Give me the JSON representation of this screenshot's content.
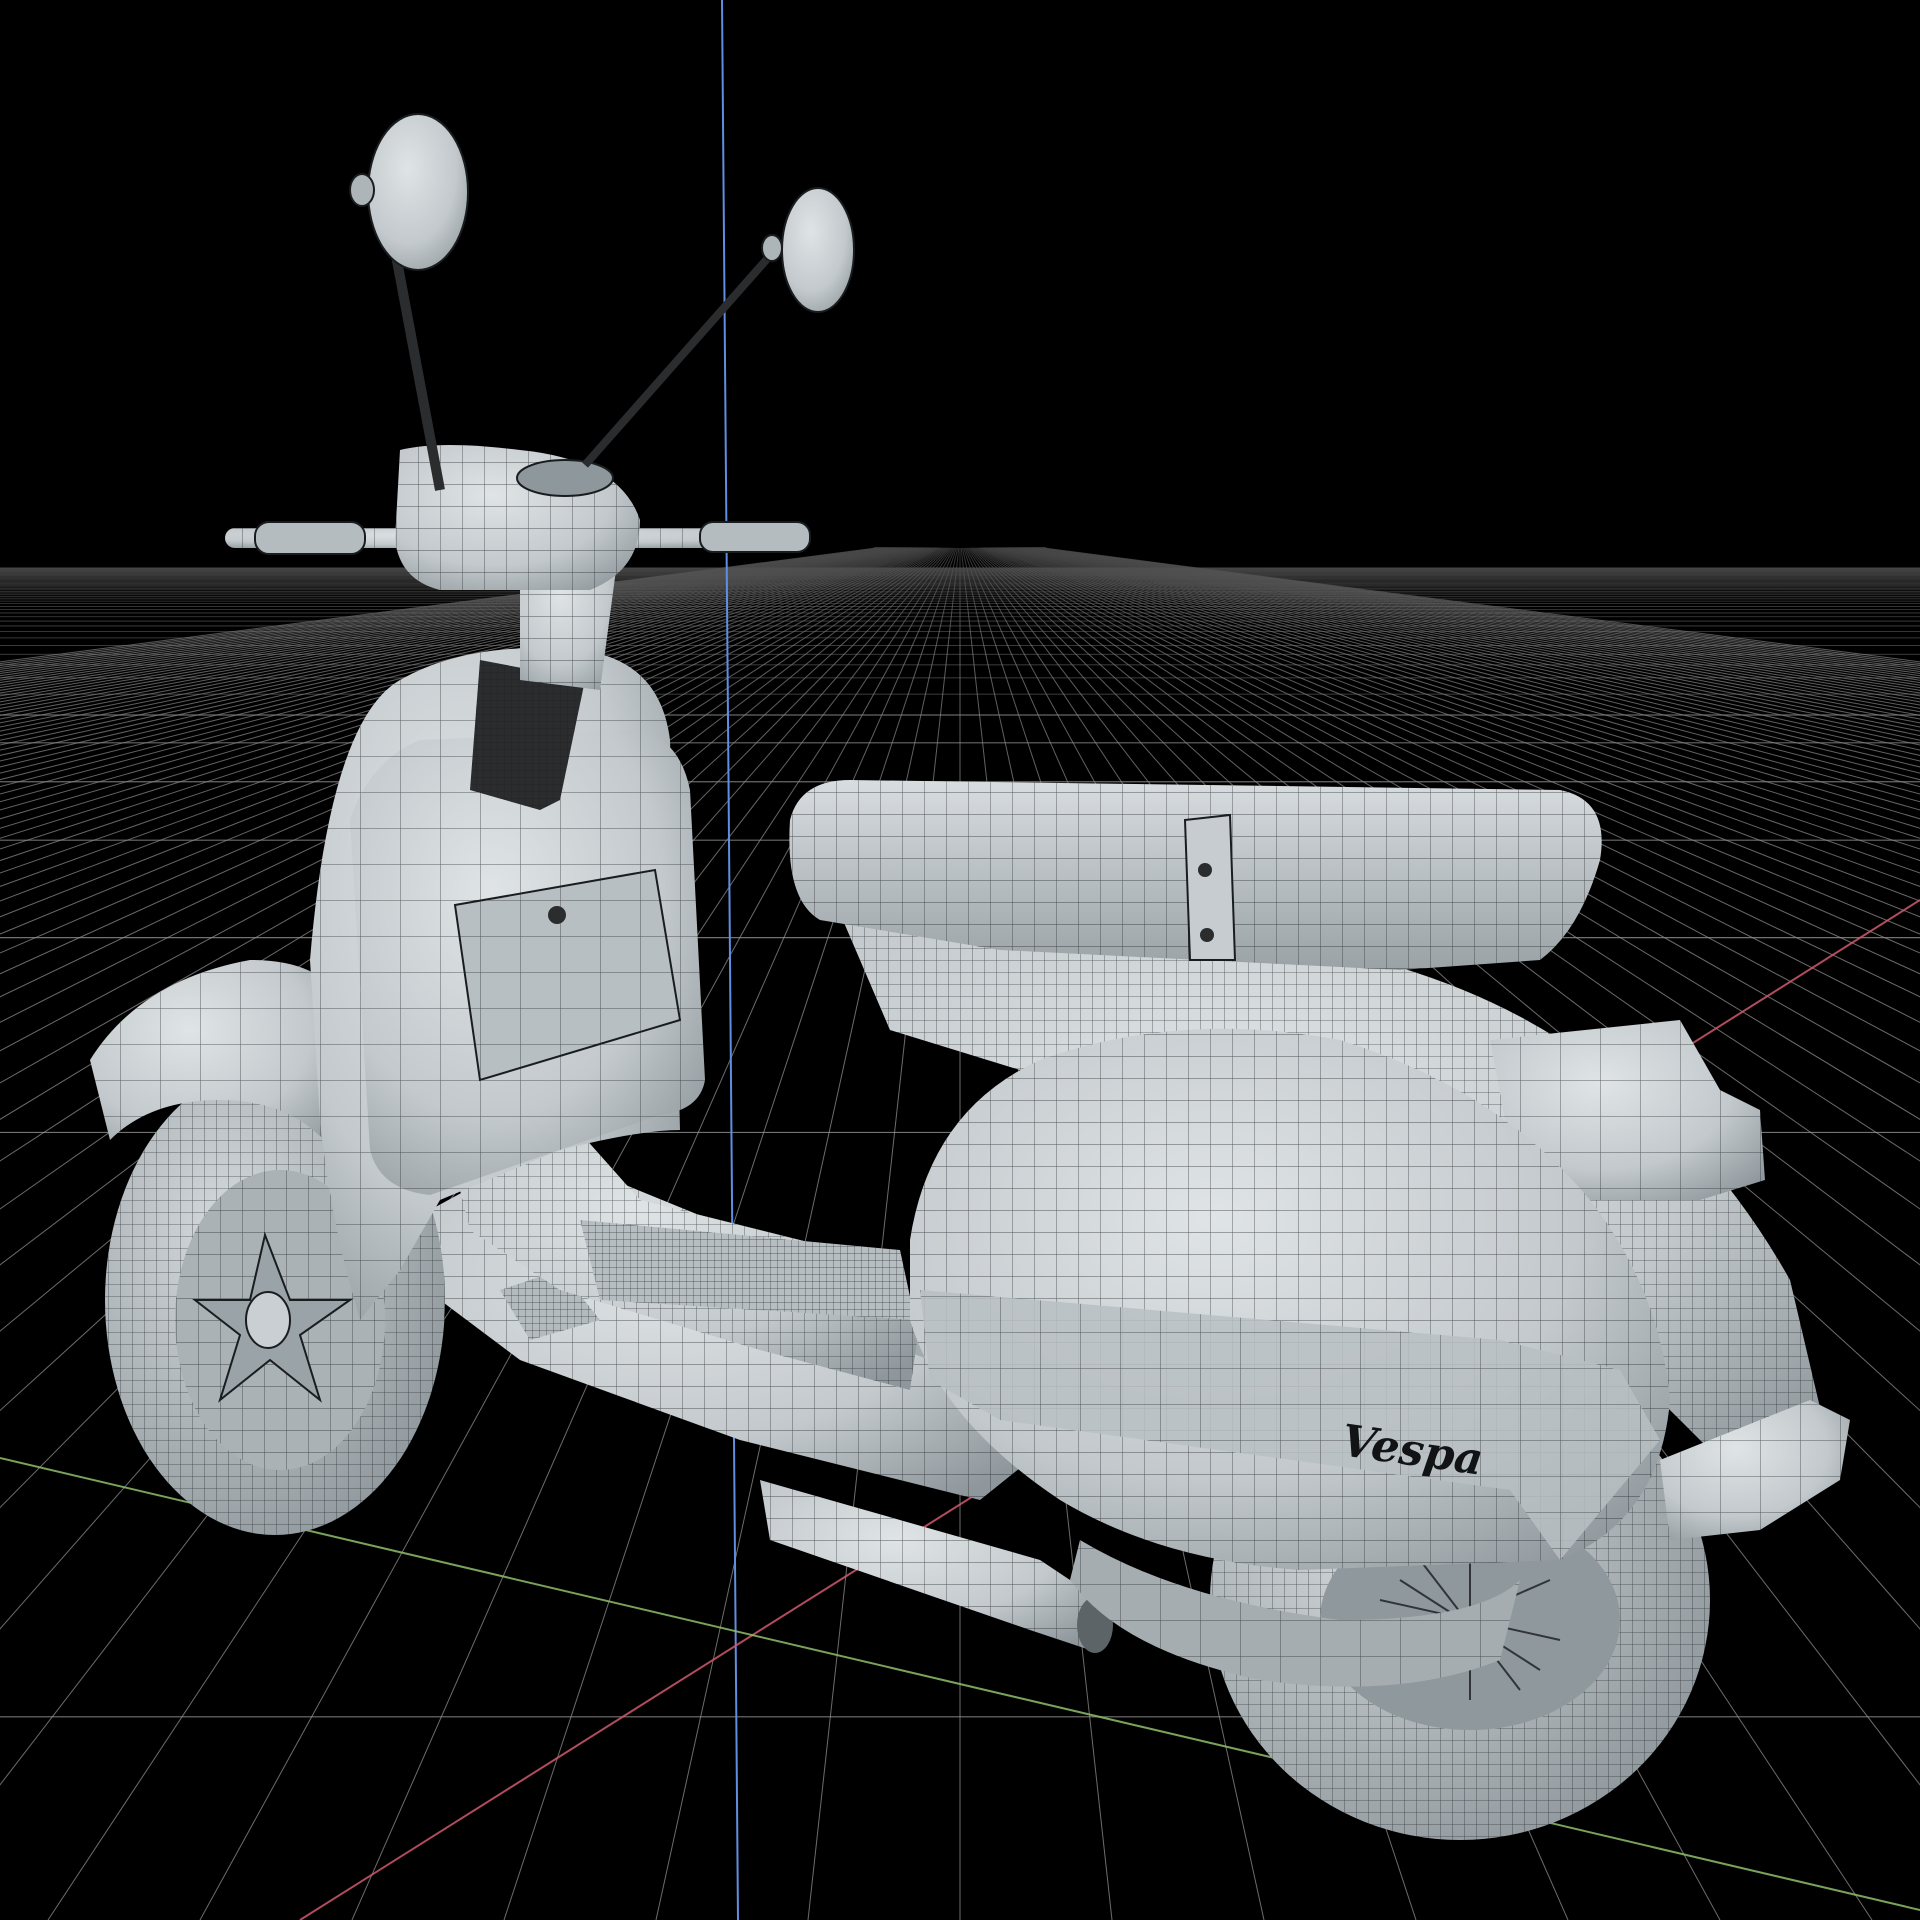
{
  "viewport": {
    "background": "#000000",
    "view_mode": "wireframe-on-shaded",
    "grid_visible": true
  },
  "colors": {
    "grid_line": "#9a9a9a",
    "axis_x": "#d05a6e",
    "axis_y": "#5f8fe0",
    "axis_z": "#8fbf6a",
    "shaded_surface": "#c3c9cc",
    "shaded_shadow": "#8e979c",
    "shaded_highlight": "#dfe4e6",
    "wireframe": "#1a1d1f",
    "dark_part": "#2a2c2e"
  },
  "model": {
    "type": "scooter",
    "badge_text": "Vespa"
  }
}
